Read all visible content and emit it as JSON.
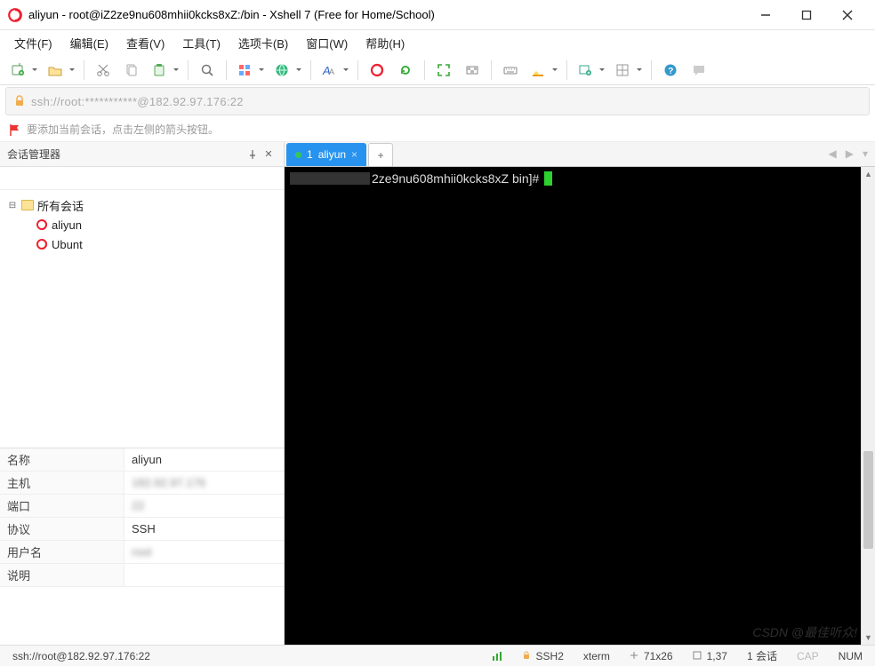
{
  "window": {
    "title": "aliyun - root@iZ2ze9nu608mhii0kcks8xZ:/bin - Xshell 7 (Free for Home/School)"
  },
  "menu": {
    "file": "文件(F)",
    "edit": "编辑(E)",
    "view": "查看(V)",
    "tools": "工具(T)",
    "tabs": "选项卡(B)",
    "window": "窗口(W)",
    "help": "帮助(H)"
  },
  "addressbar": {
    "text": "ssh://root:***********@182.92.97.176:22"
  },
  "hint": {
    "text": "要添加当前会话，点击左侧的箭头按钮。"
  },
  "sidebar": {
    "title": "会话管理器",
    "root": "所有会话",
    "items": [
      "aliyun",
      "Ubunt"
    ]
  },
  "properties": {
    "rows": [
      {
        "k": "名称",
        "v": "aliyun",
        "blur": false
      },
      {
        "k": "主机",
        "v": "182.92.97.176",
        "blur": true
      },
      {
        "k": "端口",
        "v": "22",
        "blur": true
      },
      {
        "k": "协议",
        "v": "SSH",
        "blur": false
      },
      {
        "k": "用户名",
        "v": "root",
        "blur": true
      },
      {
        "k": "说明",
        "v": "",
        "blur": false
      }
    ]
  },
  "tabs": {
    "active": {
      "index": "1",
      "label": "aliyun"
    }
  },
  "terminal": {
    "prompt_suffix": "2ze9nu608mhii0kcks8xZ bin]# "
  },
  "status": {
    "left": "ssh://root@182.92.97.176:22",
    "ssh": "SSH2",
    "term": "xterm",
    "size": "71x26",
    "pos": "1,37",
    "sessions": "1 会话",
    "caps": "CAP",
    "num": "NUM"
  },
  "watermark": "CSDN @最佳听众!"
}
